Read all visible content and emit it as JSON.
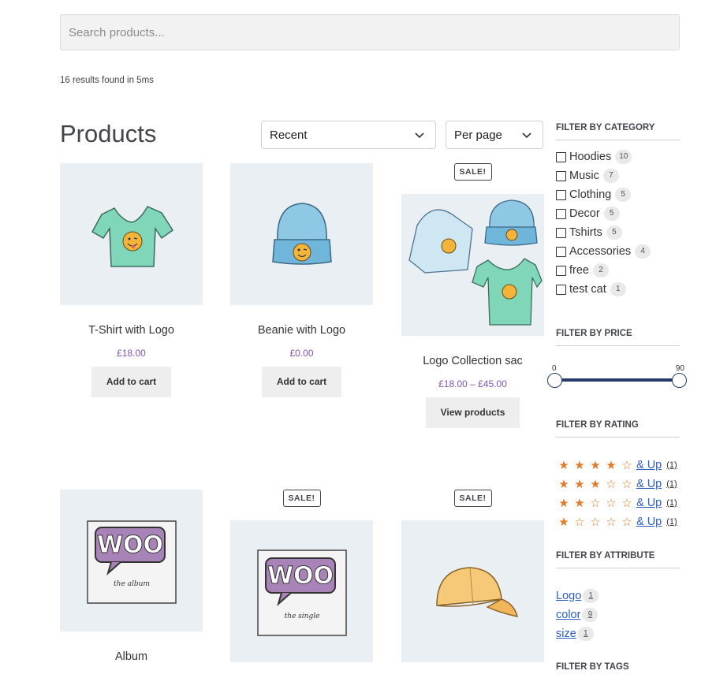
{
  "search": {
    "placeholder": "Search products..."
  },
  "results_text": "16 results found in 5ms",
  "page_title": "Products",
  "sort": {
    "selected": "Recent"
  },
  "per_page": {
    "selected": "Per page"
  },
  "products": [
    {
      "name": "T-Shirt with Logo",
      "price": "£18.00",
      "button": "Add to cart",
      "sale": ""
    },
    {
      "name": "Beanie with Logo",
      "price": "£0.00",
      "button": "Add to cart",
      "sale": ""
    },
    {
      "name": "Logo Collection sac",
      "price": "£18.00 – £45.00",
      "button": "View products",
      "sale": "SALE!"
    },
    {
      "name": "Album",
      "price": "",
      "button": "",
      "sale": ""
    },
    {
      "name": "",
      "price": "",
      "button": "",
      "sale": "SALE!"
    },
    {
      "name": "",
      "price": "",
      "button": "",
      "sale": "SALE!"
    }
  ],
  "album_art": {
    "logo_text": "WOO",
    "album_caption": "the album",
    "single_caption": "the single"
  },
  "filters": {
    "category": {
      "title": "FILTER BY CATEGORY",
      "items": [
        {
          "label": "Hoodies",
          "count": "10"
        },
        {
          "label": "Music",
          "count": "7"
        },
        {
          "label": "Clothing",
          "count": "5"
        },
        {
          "label": "Decor",
          "count": "5"
        },
        {
          "label": "Tshirts",
          "count": "5"
        },
        {
          "label": "Accessories",
          "count": "4"
        },
        {
          "label": "free",
          "count": "2"
        },
        {
          "label": "test cat",
          "count": "1"
        }
      ]
    },
    "price": {
      "title": "FILTER BY PRICE",
      "min": "0",
      "max": "90"
    },
    "rating": {
      "title": "FILTER BY RATING",
      "rows": [
        {
          "stars": 4,
          "label": "& Up",
          "count": "(1)"
        },
        {
          "stars": 3,
          "label": "& Up",
          "count": "(1)"
        },
        {
          "stars": 2,
          "label": "& Up",
          "count": "(1)"
        },
        {
          "stars": 1,
          "label": "& Up",
          "count": "(1)"
        }
      ]
    },
    "attribute": {
      "title": "FILTER BY ATTRIBUTE",
      "items": [
        {
          "label": "Logo",
          "count": "1"
        },
        {
          "label": "color",
          "count": "9"
        },
        {
          "label": "size",
          "count": "1"
        }
      ]
    },
    "tags": {
      "title": "FILTER BY TAGS"
    }
  },
  "colors": {
    "accent": "#7f54b3",
    "link": "#2c5cc5",
    "star": "#e07b2a",
    "slider": "#263a6e"
  }
}
